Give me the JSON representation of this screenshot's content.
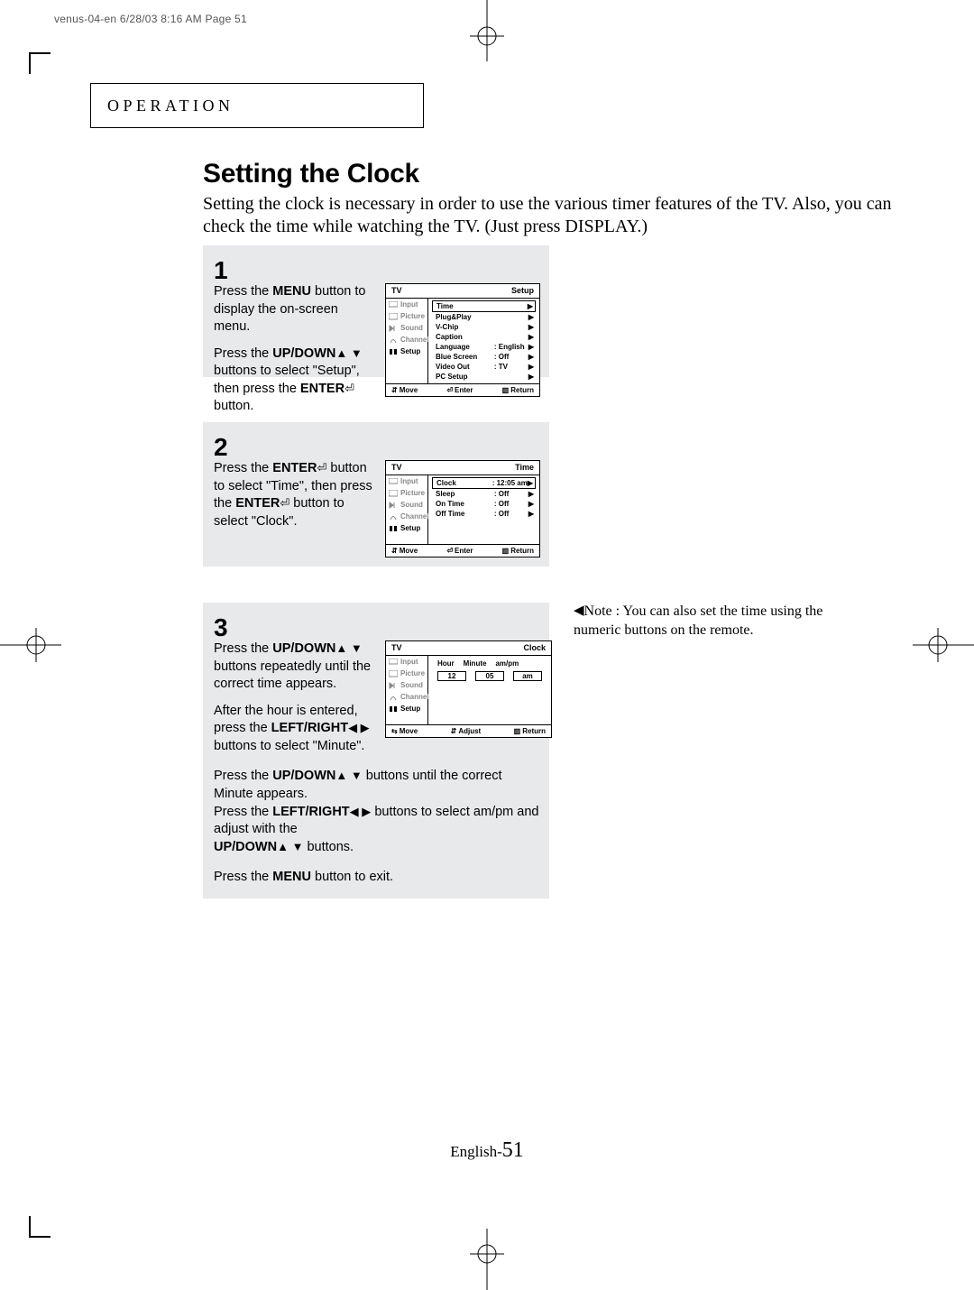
{
  "slug": "venus-04-en  6/28/03  8:16 AM  Page 51",
  "section_label": "OPERATION",
  "title": "Setting the Clock",
  "intro": "Setting the clock is  necessary in order to use the various timer features of the TV. Also, you can check the time while watching the TV. (Just press DISPLAY.)",
  "steps": {
    "s1": {
      "num": "1",
      "p1a": "Press the ",
      "p1b": "MENU",
      "p1c": " button to display the on-screen menu.",
      "p2a": "Press the ",
      "p2b": "UP/DOWN",
      "p2c": " buttons to select \"Setup\", then press the ",
      "p2d": "ENTER",
      "p2e": " button."
    },
    "s2": {
      "num": "2",
      "p1a": "Press the ",
      "p1b": "ENTER",
      "p1c": " button to select \"Time\", then press the ",
      "p1d": "ENTER",
      "p1e": " button to select \"Clock\"."
    },
    "s3": {
      "num": "3",
      "p1a": "Press the ",
      "p1b": "UP/DOWN",
      "p1c": " buttons repeatedly until the correct time appears.",
      "p2a": "After the hour is entered, press the ",
      "p2b": "LEFT/RIGHT",
      "p2c": " buttons to select \"Minute\".",
      "p3a": "Press the ",
      "p3b": "UP/DOWN",
      "p3c": " buttons until the correct Minute appears.",
      "p4a": "Press the ",
      "p4b": "LEFT/RIGHT",
      "p4c": " buttons to select am/pm and adjust with the ",
      "p4d": "UP/DOWN",
      "p4e": " buttons.",
      "p5a": "Press the ",
      "p5b": "MENU",
      "p5c": " button to exit."
    }
  },
  "osd_side": {
    "tv": "TV",
    "input": "Input",
    "picture": "Picture",
    "sound": "Sound",
    "channel": "Channel",
    "setup": "Setup"
  },
  "osd1": {
    "title_r": "Setup",
    "rows": [
      {
        "l": "Time",
        "v": "",
        "boxed": true
      },
      {
        "l": "Plug&Play",
        "v": ""
      },
      {
        "l": "V-Chip",
        "v": ""
      },
      {
        "l": "Caption",
        "v": ""
      },
      {
        "l": "Language",
        "v": ":   English"
      },
      {
        "l": "Blue Screen",
        "v": ":   Off"
      },
      {
        "l": "Video Out",
        "v": ":   TV"
      },
      {
        "l": "PC Setup",
        "v": ""
      }
    ],
    "foot": {
      "move": "Move",
      "enter": "Enter",
      "ret": "Return"
    }
  },
  "osd2": {
    "title_r": "Time",
    "rows": [
      {
        "l": "Clock",
        "v": ":   12:05 am",
        "boxed": true
      },
      {
        "l": "Sleep",
        "v": ":   Off"
      },
      {
        "l": "On Time",
        "v": ":   Off"
      },
      {
        "l": "Off Time",
        "v": ":   Off"
      }
    ],
    "foot": {
      "move": "Move",
      "enter": "Enter",
      "ret": "Return"
    }
  },
  "osd3": {
    "title_r": "Clock",
    "cols": {
      "h": "Hour",
      "m": "Minute",
      "a": "am/pm"
    },
    "vals": {
      "h": "12",
      "m": "05",
      "a": "am"
    },
    "foot": {
      "move": "Move",
      "adjust": "Adjust",
      "ret": "Return"
    }
  },
  "note": {
    "lead": "Note :",
    "body": "You can also set the time using the numeric buttons on the remote."
  },
  "page_label": "English-",
  "page_num": "51",
  "glyphs": {
    "ud": "▲ ▼",
    "lr": "◀ ▶",
    "tri_l": "◀",
    "tri_r": "▶",
    "enter": "⏎",
    "updown_sm": "⇵",
    "leftright_sm": "⇆",
    "ret": "▥"
  }
}
